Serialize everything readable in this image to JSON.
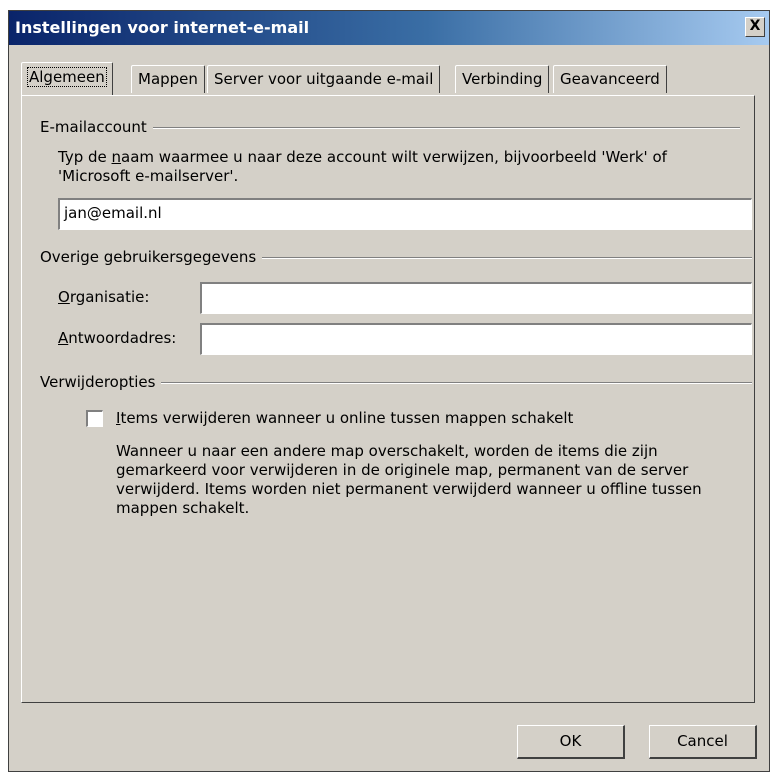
{
  "window": {
    "title": "Instellingen voor internet-e-mail",
    "close_glyph": "X"
  },
  "tabs": [
    {
      "label": "Algemeen",
      "active": true
    },
    {
      "label": "Mappen",
      "active": false
    },
    {
      "label": "Server voor uitgaande e-mail",
      "active": false
    },
    {
      "label": "Verbinding",
      "active": false
    },
    {
      "label": "Geavanceerd",
      "active": false
    }
  ],
  "email_account": {
    "heading": "E-mailaccount",
    "description_line1_pre": "Typ de ",
    "description_line1_mnemonic": "n",
    "description_line1_post": "aam waarmee u naar deze account wilt verwijzen, bijvoorbeeld 'Werk' of",
    "description_line2": "'Microsoft e-mailserver'.",
    "account_value": "jan@email.nl"
  },
  "user_info": {
    "heading": "Overige gebruikersgegevens",
    "organization_mnemonic": "O",
    "organization_label_rest": "rganisatie:",
    "organization_value": "",
    "reply_mnemonic": "A",
    "reply_label_rest": "ntwoordadres:",
    "reply_value": ""
  },
  "delete_options": {
    "heading": "Verwijderopties",
    "checkbox_mnemonic": "I",
    "checkbox_label_rest": "tems verwijderen wanneer u online tussen mappen schakelt",
    "checked": false,
    "explanation_lines": [
      "Wanneer u naar een andere map overschakelt, worden de items die zijn",
      "gemarkeerd voor verwijderen in de originele map, permanent van de server",
      "verwijderd. Items worden niet permanent verwijderd wanneer u offline tussen",
      "mappen schakelt."
    ]
  },
  "buttons": {
    "ok_label": "OK",
    "cancel_label": "Cancel"
  }
}
